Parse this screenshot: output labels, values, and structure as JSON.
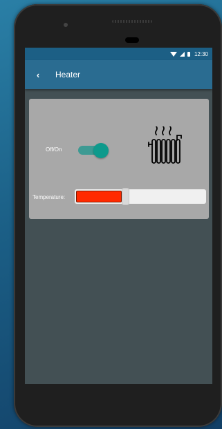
{
  "status_bar": {
    "time": "12:30",
    "icons": [
      "wifi-icon",
      "signal-icon",
      "battery-icon"
    ]
  },
  "toolbar": {
    "back_icon": "‹",
    "title": "Heater"
  },
  "controls": {
    "power_label": "Off/On",
    "power_on": true,
    "heater_icon": "radiator-icon",
    "temperature_label": "Temperature:",
    "temperature_level": 0.36
  },
  "colors": {
    "app_bar": "#2a6c91",
    "status_bar": "#1c5f85",
    "toggle_on": "#0e9a8c",
    "temperature_fill": "#ff2a00"
  }
}
